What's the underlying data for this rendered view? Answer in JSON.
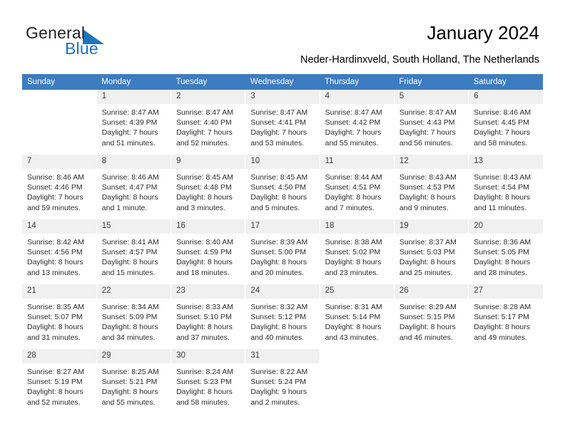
{
  "brand": {
    "name_part1": "General",
    "name_part2": "Blue",
    "logo_icon": "triangle-flag-icon",
    "accent_color": "#1b75bb"
  },
  "header": {
    "title": "January 2024",
    "subtitle": "Neder-Hardinxveld, South Holland, The Netherlands"
  },
  "calendar": {
    "header_bg": "#3c7cc0",
    "cell_header_bg": "#f0f0f0",
    "weekday_headers": [
      "Sunday",
      "Monday",
      "Tuesday",
      "Wednesday",
      "Thursday",
      "Friday",
      "Saturday"
    ],
    "weeks": [
      [
        {
          "day": "",
          "sunrise": "",
          "sunset": "",
          "daylight_line1": "",
          "daylight_line2": ""
        },
        {
          "day": "1",
          "sunrise": "Sunrise: 8:47 AM",
          "sunset": "Sunset: 4:39 PM",
          "daylight_line1": "Daylight: 7 hours",
          "daylight_line2": "and 51 minutes."
        },
        {
          "day": "2",
          "sunrise": "Sunrise: 8:47 AM",
          "sunset": "Sunset: 4:40 PM",
          "daylight_line1": "Daylight: 7 hours",
          "daylight_line2": "and 52 minutes."
        },
        {
          "day": "3",
          "sunrise": "Sunrise: 8:47 AM",
          "sunset": "Sunset: 4:41 PM",
          "daylight_line1": "Daylight: 7 hours",
          "daylight_line2": "and 53 minutes."
        },
        {
          "day": "4",
          "sunrise": "Sunrise: 8:47 AM",
          "sunset": "Sunset: 4:42 PM",
          "daylight_line1": "Daylight: 7 hours",
          "daylight_line2": "and 55 minutes."
        },
        {
          "day": "5",
          "sunrise": "Sunrise: 8:47 AM",
          "sunset": "Sunset: 4:43 PM",
          "daylight_line1": "Daylight: 7 hours",
          "daylight_line2": "and 56 minutes."
        },
        {
          "day": "6",
          "sunrise": "Sunrise: 8:46 AM",
          "sunset": "Sunset: 4:45 PM",
          "daylight_line1": "Daylight: 7 hours",
          "daylight_line2": "and 58 minutes."
        }
      ],
      [
        {
          "day": "7",
          "sunrise": "Sunrise: 8:46 AM",
          "sunset": "Sunset: 4:46 PM",
          "daylight_line1": "Daylight: 7 hours",
          "daylight_line2": "and 59 minutes."
        },
        {
          "day": "8",
          "sunrise": "Sunrise: 8:46 AM",
          "sunset": "Sunset: 4:47 PM",
          "daylight_line1": "Daylight: 8 hours",
          "daylight_line2": "and 1 minute."
        },
        {
          "day": "9",
          "sunrise": "Sunrise: 8:45 AM",
          "sunset": "Sunset: 4:48 PM",
          "daylight_line1": "Daylight: 8 hours",
          "daylight_line2": "and 3 minutes."
        },
        {
          "day": "10",
          "sunrise": "Sunrise: 8:45 AM",
          "sunset": "Sunset: 4:50 PM",
          "daylight_line1": "Daylight: 8 hours",
          "daylight_line2": "and 5 minutes."
        },
        {
          "day": "11",
          "sunrise": "Sunrise: 8:44 AM",
          "sunset": "Sunset: 4:51 PM",
          "daylight_line1": "Daylight: 8 hours",
          "daylight_line2": "and 7 minutes."
        },
        {
          "day": "12",
          "sunrise": "Sunrise: 8:43 AM",
          "sunset": "Sunset: 4:53 PM",
          "daylight_line1": "Daylight: 8 hours",
          "daylight_line2": "and 9 minutes."
        },
        {
          "day": "13",
          "sunrise": "Sunrise: 8:43 AM",
          "sunset": "Sunset: 4:54 PM",
          "daylight_line1": "Daylight: 8 hours",
          "daylight_line2": "and 11 minutes."
        }
      ],
      [
        {
          "day": "14",
          "sunrise": "Sunrise: 8:42 AM",
          "sunset": "Sunset: 4:56 PM",
          "daylight_line1": "Daylight: 8 hours",
          "daylight_line2": "and 13 minutes."
        },
        {
          "day": "15",
          "sunrise": "Sunrise: 8:41 AM",
          "sunset": "Sunset: 4:57 PM",
          "daylight_line1": "Daylight: 8 hours",
          "daylight_line2": "and 15 minutes."
        },
        {
          "day": "16",
          "sunrise": "Sunrise: 8:40 AM",
          "sunset": "Sunset: 4:59 PM",
          "daylight_line1": "Daylight: 8 hours",
          "daylight_line2": "and 18 minutes."
        },
        {
          "day": "17",
          "sunrise": "Sunrise: 8:39 AM",
          "sunset": "Sunset: 5:00 PM",
          "daylight_line1": "Daylight: 8 hours",
          "daylight_line2": "and 20 minutes."
        },
        {
          "day": "18",
          "sunrise": "Sunrise: 8:38 AM",
          "sunset": "Sunset: 5:02 PM",
          "daylight_line1": "Daylight: 8 hours",
          "daylight_line2": "and 23 minutes."
        },
        {
          "day": "19",
          "sunrise": "Sunrise: 8:37 AM",
          "sunset": "Sunset: 5:03 PM",
          "daylight_line1": "Daylight: 8 hours",
          "daylight_line2": "and 25 minutes."
        },
        {
          "day": "20",
          "sunrise": "Sunrise: 8:36 AM",
          "sunset": "Sunset: 5:05 PM",
          "daylight_line1": "Daylight: 8 hours",
          "daylight_line2": "and 28 minutes."
        }
      ],
      [
        {
          "day": "21",
          "sunrise": "Sunrise: 8:35 AM",
          "sunset": "Sunset: 5:07 PM",
          "daylight_line1": "Daylight: 8 hours",
          "daylight_line2": "and 31 minutes."
        },
        {
          "day": "22",
          "sunrise": "Sunrise: 8:34 AM",
          "sunset": "Sunset: 5:09 PM",
          "daylight_line1": "Daylight: 8 hours",
          "daylight_line2": "and 34 minutes."
        },
        {
          "day": "23",
          "sunrise": "Sunrise: 8:33 AM",
          "sunset": "Sunset: 5:10 PM",
          "daylight_line1": "Daylight: 8 hours",
          "daylight_line2": "and 37 minutes."
        },
        {
          "day": "24",
          "sunrise": "Sunrise: 8:32 AM",
          "sunset": "Sunset: 5:12 PM",
          "daylight_line1": "Daylight: 8 hours",
          "daylight_line2": "and 40 minutes."
        },
        {
          "day": "25",
          "sunrise": "Sunrise: 8:31 AM",
          "sunset": "Sunset: 5:14 PM",
          "daylight_line1": "Daylight: 8 hours",
          "daylight_line2": "and 43 minutes."
        },
        {
          "day": "26",
          "sunrise": "Sunrise: 8:29 AM",
          "sunset": "Sunset: 5:15 PM",
          "daylight_line1": "Daylight: 8 hours",
          "daylight_line2": "and 46 minutes."
        },
        {
          "day": "27",
          "sunrise": "Sunrise: 8:28 AM",
          "sunset": "Sunset: 5:17 PM",
          "daylight_line1": "Daylight: 8 hours",
          "daylight_line2": "and 49 minutes."
        }
      ],
      [
        {
          "day": "28",
          "sunrise": "Sunrise: 8:27 AM",
          "sunset": "Sunset: 5:19 PM",
          "daylight_line1": "Daylight: 8 hours",
          "daylight_line2": "and 52 minutes."
        },
        {
          "day": "29",
          "sunrise": "Sunrise: 8:25 AM",
          "sunset": "Sunset: 5:21 PM",
          "daylight_line1": "Daylight: 8 hours",
          "daylight_line2": "and 55 minutes."
        },
        {
          "day": "30",
          "sunrise": "Sunrise: 8:24 AM",
          "sunset": "Sunset: 5:23 PM",
          "daylight_line1": "Daylight: 8 hours",
          "daylight_line2": "and 58 minutes."
        },
        {
          "day": "31",
          "sunrise": "Sunrise: 8:22 AM",
          "sunset": "Sunset: 5:24 PM",
          "daylight_line1": "Daylight: 9 hours",
          "daylight_line2": "and 2 minutes."
        },
        {
          "day": "",
          "sunrise": "",
          "sunset": "",
          "daylight_line1": "",
          "daylight_line2": ""
        },
        {
          "day": "",
          "sunrise": "",
          "sunset": "",
          "daylight_line1": "",
          "daylight_line2": ""
        },
        {
          "day": "",
          "sunrise": "",
          "sunset": "",
          "daylight_line1": "",
          "daylight_line2": ""
        }
      ]
    ]
  }
}
